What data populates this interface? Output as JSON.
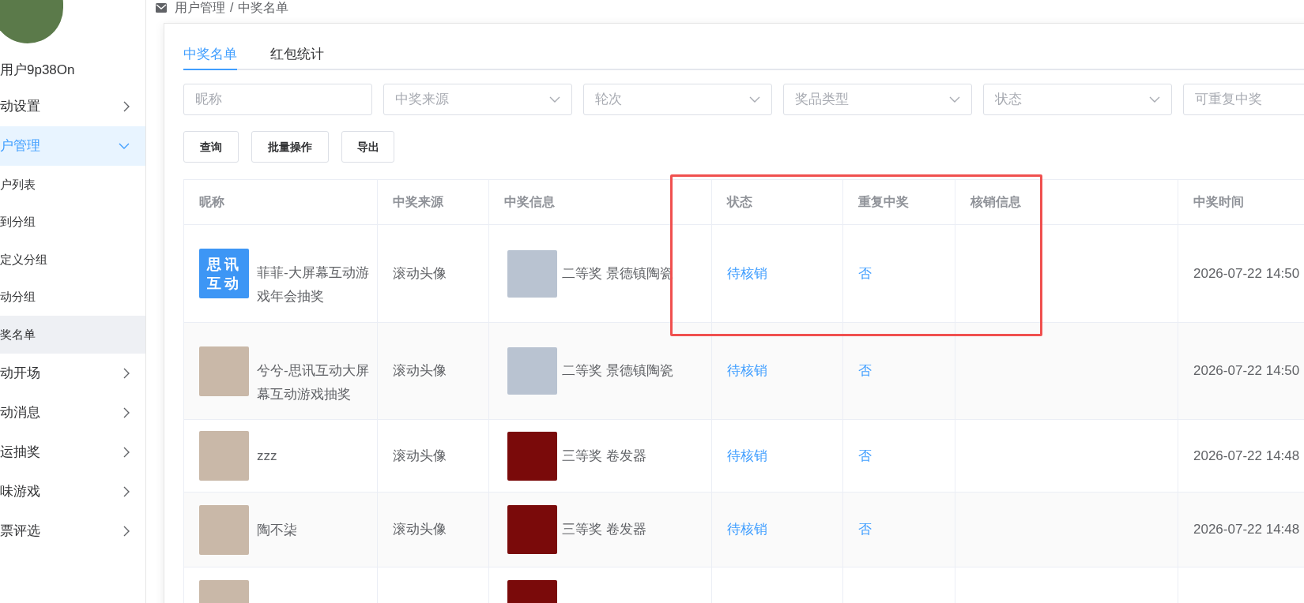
{
  "user": {
    "name": "用户9p38On"
  },
  "sidebar": {
    "items": [
      {
        "label": "动设置",
        "expanded": false,
        "selected": false
      },
      {
        "label": "户管理",
        "expanded": true,
        "selected": true,
        "children": [
          {
            "label": "户列表",
            "selected": false
          },
          {
            "label": "到分组",
            "selected": false
          },
          {
            "label": "定义分组",
            "selected": false
          },
          {
            "label": "动分组",
            "selected": false
          },
          {
            "label": "奖名单",
            "selected": true
          }
        ]
      },
      {
        "label": "动开场",
        "expanded": false,
        "selected": false
      },
      {
        "label": "动消息",
        "expanded": false,
        "selected": false
      },
      {
        "label": "运抽奖",
        "expanded": false,
        "selected": false
      },
      {
        "label": "味游戏",
        "expanded": false,
        "selected": false
      },
      {
        "label": "票评选",
        "expanded": false,
        "selected": false
      }
    ]
  },
  "breadcrumb": [
    "用户管理",
    "/",
    "中奖名单"
  ],
  "tabs": [
    {
      "label": "中奖名单",
      "selected": true
    },
    {
      "label": "红包统计",
      "selected": false
    }
  ],
  "filters": [
    {
      "kind": "input",
      "placeholder": "昵称"
    },
    {
      "kind": "select",
      "placeholder": "中奖来源"
    },
    {
      "kind": "select",
      "placeholder": "轮次"
    },
    {
      "kind": "select",
      "placeholder": "奖品类型"
    },
    {
      "kind": "select",
      "placeholder": "状态"
    },
    {
      "kind": "input",
      "placeholder": "可重复中奖"
    }
  ],
  "buttons": [
    "查询",
    "批量操作",
    "导出"
  ],
  "table": {
    "columns": [
      "昵称",
      "中奖来源",
      "中奖信息",
      "状态",
      "重复中奖",
      "核销信息",
      "中奖时间"
    ],
    "rows": [
      {
        "avatar": {
          "kind": "logo",
          "text": [
            "思讯",
            "互动"
          ]
        },
        "nickname": "菲菲-大屏幕互动游戏年会抽奖",
        "source": "滚动头像",
        "prize_image": {
          "kind": "vase"
        },
        "prize": "二等奖 景德镇陶瓷",
        "status": "待核销",
        "repeat": "否",
        "time": "2026-07-22 14:50"
      },
      {
        "avatar": {
          "kind": "photo"
        },
        "nickname": "兮兮-思讯互动大屏幕互动游戏抽奖",
        "source": "滚动头像",
        "prize_image": {
          "kind": "vase"
        },
        "prize": "二等奖 景德镇陶瓷",
        "status": "待核销",
        "repeat": "否",
        "time": "2026-07-22 14:50"
      },
      {
        "avatar": {
          "kind": "photo"
        },
        "nickname": "zzz",
        "source": "滚动头像",
        "prize_image": {
          "kind": "gift"
        },
        "prize": "三等奖 卷发器",
        "status": "待核销",
        "repeat": "否",
        "time": "2026-07-22 14:48"
      },
      {
        "avatar": {
          "kind": "photo"
        },
        "nickname": "陶不柒",
        "source": "滚动头像",
        "prize_image": {
          "kind": "gift"
        },
        "prize": "三等奖 卷发器",
        "status": "待核销",
        "repeat": "否",
        "time": "2026-07-22 14:48"
      },
      {
        "avatar": {
          "kind": "photo"
        },
        "prize_image": {
          "kind": "gift"
        }
      }
    ]
  }
}
